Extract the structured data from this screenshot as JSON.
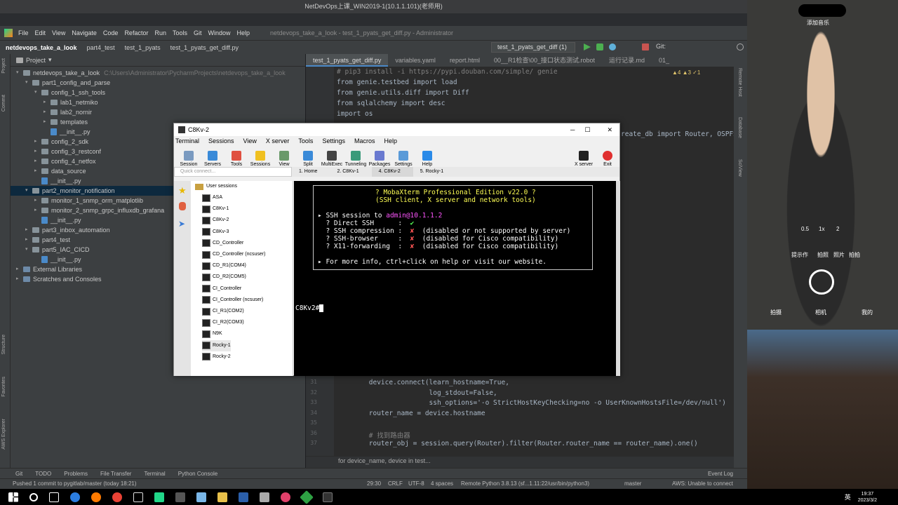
{
  "remote_title": "NetDevOps上课_WIN2019-1(10.1.1.101)(老师用)",
  "ide": {
    "menu": [
      "File",
      "Edit",
      "View",
      "Navigate",
      "Code",
      "Refactor",
      "Run",
      "Tools",
      "Git",
      "Window",
      "Help"
    ],
    "window_title": "netdevops_take_a_look - test_1_pyats_get_diff.py - Administrator",
    "breadcrumbs": [
      "netdevops_take_a_look",
      "part4_test",
      "test_1_pyats",
      "test_1_pyats_get_diff.py"
    ],
    "run_config": "test_1_pyats_get_diff (1)",
    "git_label": "Git:",
    "project_label": "Project",
    "tree": [
      {
        "label": "netdevops_take_a_look",
        "path": "C:\\Users\\Administrator\\PycharmProjects\\netdevops_take_a_look",
        "kind": "folder",
        "arrow": "▾",
        "depth": 0
      },
      {
        "label": "part1_config_and_parse",
        "kind": "folder",
        "arrow": "▾",
        "depth": 1
      },
      {
        "label": "config_1_ssh_tools",
        "kind": "folder",
        "arrow": "▾",
        "depth": 2
      },
      {
        "label": "lab1_netmiko",
        "kind": "folder",
        "arrow": "▸",
        "depth": 3
      },
      {
        "label": "lab2_nornir",
        "kind": "folder",
        "arrow": "▸",
        "depth": 3
      },
      {
        "label": "templates",
        "kind": "folder",
        "arrow": "▸",
        "depth": 3
      },
      {
        "label": "__init__.py",
        "kind": "file",
        "arrow": "",
        "depth": 3
      },
      {
        "label": "config_2_sdk",
        "kind": "folder",
        "arrow": "▸",
        "depth": 2
      },
      {
        "label": "config_3_restconf",
        "kind": "folder",
        "arrow": "▸",
        "depth": 2
      },
      {
        "label": "config_4_netfox",
        "kind": "folder",
        "arrow": "▸",
        "depth": 2
      },
      {
        "label": "data_source",
        "kind": "folder",
        "arrow": "▸",
        "depth": 2
      },
      {
        "label": "__init__.py",
        "kind": "file",
        "arrow": "",
        "depth": 2
      },
      {
        "label": "part2_monitor_notification",
        "kind": "folder",
        "arrow": "▾",
        "depth": 1,
        "selected": true
      },
      {
        "label": "monitor_1_snmp_orm_matplotlib",
        "kind": "folder",
        "arrow": "▸",
        "depth": 2
      },
      {
        "label": "monitor_2_snmp_grpc_influxdb_grafana",
        "kind": "folder",
        "arrow": "▸",
        "depth": 2
      },
      {
        "label": "__init__.py",
        "kind": "file",
        "arrow": "",
        "depth": 2
      },
      {
        "label": "part3_inbox_automation",
        "kind": "folder",
        "arrow": "▸",
        "depth": 1
      },
      {
        "label": "part4_test",
        "kind": "folder",
        "arrow": "▸",
        "depth": 1
      },
      {
        "label": "part5_IAC_CICD",
        "kind": "folder",
        "arrow": "▾",
        "depth": 1
      },
      {
        "label": "__init__.py",
        "kind": "file",
        "arrow": "",
        "depth": 2
      },
      {
        "label": "External Libraries",
        "kind": "lib",
        "arrow": "▸",
        "depth": 0
      },
      {
        "label": "Scratches and Consoles",
        "kind": "lib",
        "arrow": "▸",
        "depth": 0
      }
    ],
    "editor_tabs": [
      "test_1_pyats_get_diff.py",
      "variables.yaml",
      "report.html",
      "00__R1检查\\00_接口状态测试.robot",
      "运行记录.md",
      "01_"
    ],
    "inspections": "▲4 ▲3 ✓1",
    "code_top": [
      "# pip3 install -i https://pypi.douban.com/simple/ genie",
      "from genie.testbed import load",
      "from genie.utils.diff import Diff",
      "from sqlalchemy import desc",
      "import os"
    ],
    "code_right_fragment": "reate_db import Router, OSPFS",
    "code_bottom": [
      {
        "ln": "31",
        "text": "        device.connect(learn_hostname=True,"
      },
      {
        "ln": "32",
        "text": "                       log_stdout=False,"
      },
      {
        "ln": "33",
        "text": "                       ssh_options='-o StrictHostKeyChecking=no -o UserKnownHostsFile=/dev/null')"
      },
      {
        "ln": "34",
        "text": "        router_name = device.hostname"
      },
      {
        "ln": "35",
        "text": ""
      },
      {
        "ln": "36",
        "text": "        # 找到路由器"
      },
      {
        "ln": "37",
        "text": "        router_obj = session.query(Router).filter(Router.router_name == router_name).one()"
      }
    ],
    "code_footer": "for device_name, device in test...",
    "left_tools": [
      "Project",
      "Commit",
      "Structure",
      "Favorites",
      "AWS Explorer"
    ],
    "right_tools": [
      "Remote Host",
      "Database",
      "SciView"
    ],
    "bottom_tools": [
      "Git",
      "TODO",
      "Problems",
      "File Transfer",
      "Terminal",
      "Python Console"
    ],
    "event_log": "Event Log",
    "status_left": "Pushed 1 commit to pygitlab/master (today 18:21)",
    "status_right": [
      "29:30",
      "CRLF",
      "UTF-8",
      "4 spaces",
      "Remote Python 3.8.13 (sf...1.11:22/usr/bin/python3)",
      "master",
      "AWS: Unable to connect"
    ]
  },
  "moba": {
    "title": "C8Kv-2",
    "menu": [
      "Terminal",
      "Sessions",
      "View",
      "X server",
      "Tools",
      "Settings",
      "Macros",
      "Help"
    ],
    "toolbar": [
      "Session",
      "Servers",
      "Tools",
      "Sessions",
      "View",
      "Split",
      "MultiExec",
      "Tunneling",
      "Packages",
      "Settings",
      "Help"
    ],
    "toolbar_right": [
      "X server",
      "Exit"
    ],
    "quick_connect": "Quick connect...",
    "tabs": [
      "1. Home",
      "2. C8Kv-1",
      "4. C8Kv-2",
      "5. Rocky-1"
    ],
    "user_sessions": "User sessions",
    "sessions": [
      "ASA",
      "C8Kv-1",
      "C8Kv-2",
      "C8Kv-3",
      "CD_Controller",
      "CD_Controller (ncsuser)",
      "CD_R1(COM4)",
      "CD_R2(COM5)",
      "CI_Controller",
      "CI_Controller (ncsuser)",
      "CI_R1(COM2)",
      "CI_R2(COM3)",
      "N9K",
      "Rocky-1",
      "Rocky-2"
    ],
    "banner": {
      "line1": "? MobaXterm Professional Edition v22.0 ?",
      "line2": "(SSH client, X server and network tools)",
      "ssh_prefix": "▸ SSH session to ",
      "ssh_target": "admin@10.1.1.2",
      "rows": [
        {
          "label": "  ? Direct SSH      :  ",
          "mark": "✔",
          "text": ""
        },
        {
          "label": "  ? SSH compression :  ",
          "mark": "✘",
          "text": "  (disabled or not supported by server)"
        },
        {
          "label": "  ? SSH-browser     :  ",
          "mark": "✘",
          "text": "  (disabled for Cisco compatibility)"
        },
        {
          "label": "  ? X11-forwarding  :  ",
          "mark": "✘",
          "text": "  (disabled for Cisco compatibility)"
        }
      ],
      "info_line": "▸ For more info, ctrl+click on help or visit our website."
    },
    "prompt": "C8Kv2#"
  },
  "webcam": {
    "top_label": "添加音乐",
    "zoom": [
      "0.5",
      "1x",
      "2"
    ],
    "modes": [
      "提示作",
      "拍照",
      "照片",
      "拍拍"
    ],
    "bottom": [
      "拍摄",
      "相机",
      "我的"
    ]
  },
  "taskbar": {
    "time": "19:37",
    "date": "2023/3/2",
    "lang": "英"
  },
  "colors": {
    "ide_bg": "#2b2b2b",
    "panel": "#3c3f41",
    "selected": "#0d293e",
    "accent": "#4a88c7",
    "terminal_bg": "#000000"
  }
}
